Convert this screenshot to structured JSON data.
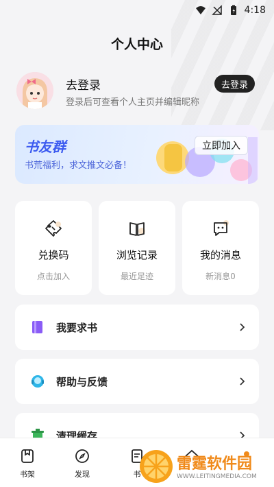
{
  "status": {
    "time": "4:18"
  },
  "header": {
    "title": "个人中心"
  },
  "profile": {
    "name": "去登录",
    "subtitle": "登录后可查看个人主页并编辑昵称",
    "login_button": "去登录"
  },
  "banner": {
    "title": "书友群",
    "subtitle": "书荒福利，求文推文必备！",
    "button": "立即加入"
  },
  "cards": [
    {
      "label": "兑换码",
      "sub": "点击加入",
      "icon": "ticket-icon"
    },
    {
      "label": "浏览记录",
      "sub": "最近足迹",
      "icon": "book-icon"
    },
    {
      "label": "我的消息",
      "sub": "新消息0",
      "icon": "message-icon"
    }
  ],
  "menu": [
    {
      "label": "我要求书",
      "icon": "request-book-icon",
      "color": "#8a5cf6"
    },
    {
      "label": "帮助与反馈",
      "icon": "help-icon",
      "color": "#2fb6e8"
    },
    {
      "label": "清理缓存",
      "icon": "trash-icon",
      "color": "#3cb55a"
    }
  ],
  "tabs": [
    {
      "label": "书架",
      "icon": "bookshelf-icon"
    },
    {
      "label": "发现",
      "icon": "compass-icon"
    },
    {
      "label": "书",
      "icon": "document-icon"
    },
    {
      "label": "",
      "icon": "home-icon"
    },
    {
      "label": "",
      "icon": "profile-icon"
    }
  ],
  "watermark": {
    "text": "雷霆软件园",
    "url": "WWW.LEITINGMEDIA.COM"
  },
  "colors": {
    "accent": "#3c5bf0",
    "brand": "#f08a1a"
  }
}
